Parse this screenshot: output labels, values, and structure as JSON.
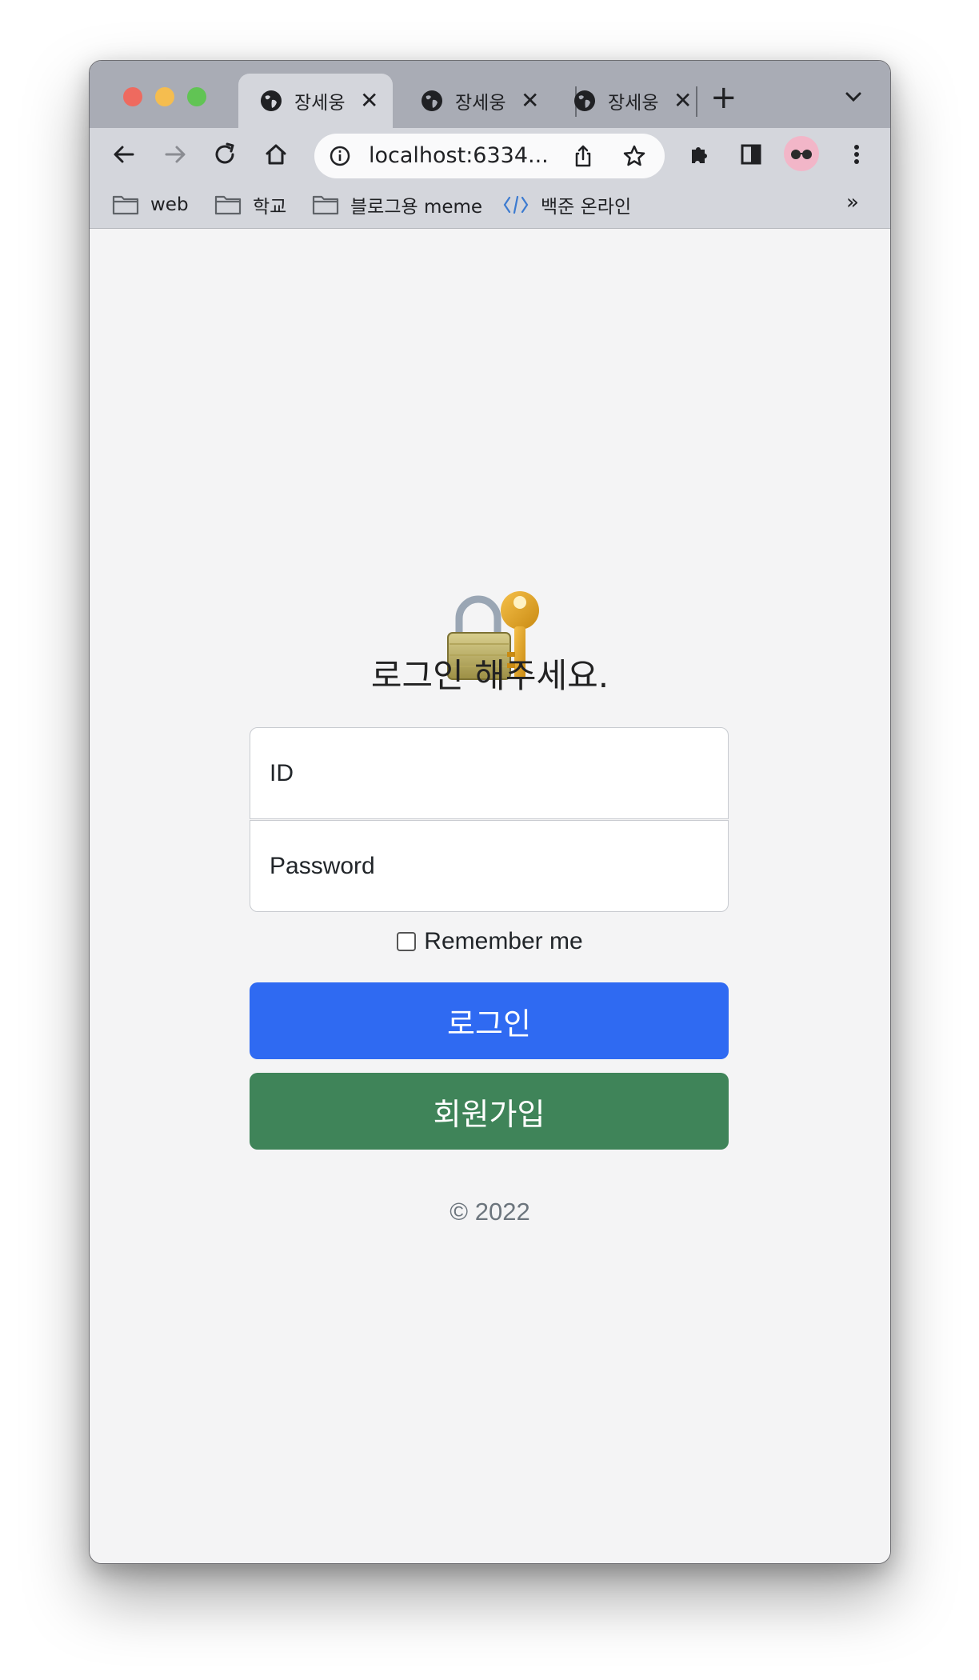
{
  "browser": {
    "tabs": [
      {
        "title": "장세웅",
        "active": true
      },
      {
        "title": "장세웅",
        "active": false
      },
      {
        "title": "장세웅",
        "active": false
      }
    ],
    "new_tab_label": "+",
    "url": "localhost:6334...",
    "bookmarks": [
      {
        "label": "web",
        "icon": "folder-icon"
      },
      {
        "label": "학교",
        "icon": "folder-icon"
      },
      {
        "label": "블로그용 meme",
        "icon": "folder-icon"
      },
      {
        "label": "백준 온라인",
        "icon": "code-icon"
      }
    ],
    "bookmarks_more": "»"
  },
  "page": {
    "heading": "로그인 해주세요.",
    "id_placeholder": "ID",
    "password_placeholder": "Password",
    "remember_label": "Remember me",
    "login_button": "로그인",
    "signup_button": "회원가입",
    "footer": "© 2022"
  },
  "colors": {
    "login_button": "#2f6af2",
    "signup_button": "#3f8459",
    "page_background": "#f4f4f5"
  }
}
